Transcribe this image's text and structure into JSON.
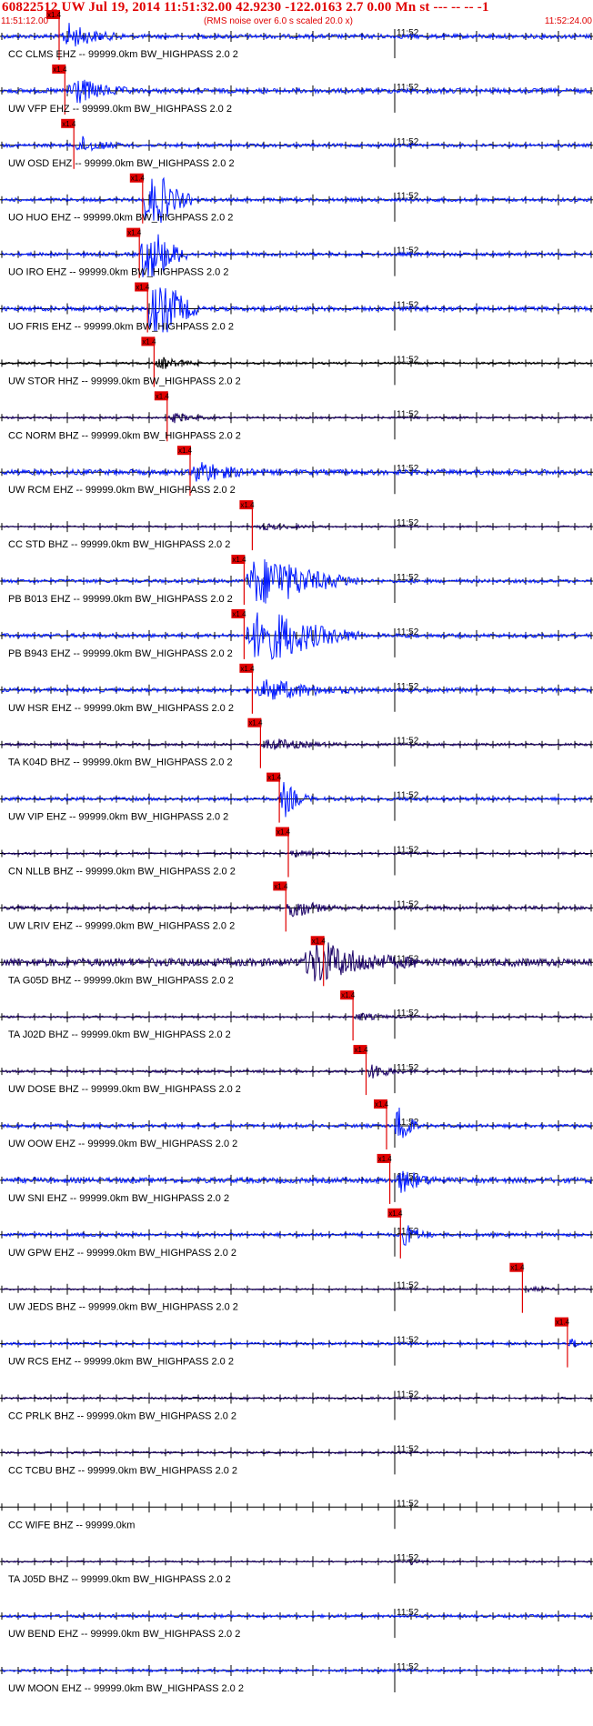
{
  "header": {
    "title": "60822512 UW Jul 19, 2014 11:51:32.00   42.9230 -122.0163  2.7 0.00 Mn st --- -- --   -1",
    "start_time": "11:51:12.00",
    "end_time": "11:52:24.00",
    "scale_note": "(RMS noise over 6.0 s scaled 20.0 x)"
  },
  "chart_data": {
    "type": "line",
    "x_range_seconds": [
      0,
      72
    ],
    "x_start": "11:51:12.00",
    "x_end": "11:52:24.00",
    "minute_mark_label": "11:52",
    "minute_mark_second": 48,
    "tick_interval_seconds": 2,
    "pick_label": "x1.4",
    "colors": {
      "blue": "#0018ff",
      "navy": "#1a0066",
      "black": "#000000",
      "red": "#e00000"
    },
    "traces": [
      {
        "label": "CC CLMS EHZ -- 99999.0km BW_HIGHPASS  2.0  2",
        "color": "blue",
        "pick_s": 7.0,
        "burst": [
          7.0,
          8.0,
          2.5
        ],
        "amp": 1.0
      },
      {
        "label": "UW VFP EHZ -- 99999.0km BW_HIGHPASS  2.0  2",
        "color": "blue",
        "pick_s": 7.7,
        "burst": [
          7.7,
          8.0,
          2.8
        ],
        "amp": 1.1
      },
      {
        "label": "UW OSD EHZ -- 99999.0km BW_HIGHPASS  2.0  2",
        "color": "blue",
        "pick_s": 8.8,
        "burst": [
          8.8,
          6.0,
          2.2
        ],
        "amp": 0.8
      },
      {
        "label": "UO HUO EHZ -- 99999.0km BW_HIGHPASS  2.0  2",
        "color": "blue",
        "pick_s": 17.2,
        "burst": [
          17.2,
          6.0,
          12.0
        ],
        "amp": 0.8
      },
      {
        "label": "UO IRO EHZ -- 99999.0km BW_HIGHPASS  2.0  2",
        "color": "blue",
        "pick_s": 16.8,
        "burst": [
          16.8,
          6.0,
          12.0
        ],
        "amp": 0.8
      },
      {
        "label": "UO FRIS EHZ -- 99999.0km BW_HIGHPASS  2.0  2",
        "color": "blue",
        "pick_s": 17.8,
        "burst": [
          17.8,
          6.0,
          12.0
        ],
        "amp": 1.0
      },
      {
        "label": "UW STOR HHZ -- 99999.0km BW_HIGHPASS  2.0  2",
        "color": "black",
        "pick_s": 18.6,
        "burst": [
          18.6,
          6.0,
          2.5
        ],
        "amp": 0.5
      },
      {
        "label": "CC NORM BHZ -- 99999.0km BW_HIGHPASS  2.0  2",
        "color": "navy",
        "pick_s": 20.2,
        "burst": [
          20.2,
          6.0,
          1.8
        ],
        "amp": 0.5
      },
      {
        "label": "UW RCM EHZ -- 99999.0km BW_HIGHPASS  2.0  2",
        "color": "blue",
        "pick_s": 23.0,
        "burst": [
          23.0,
          8.0,
          2.0
        ],
        "amp": 1.2
      },
      {
        "label": "CC STD BHZ -- 99999.0km BW_HIGHPASS  2.0  2",
        "color": "navy",
        "pick_s": 30.6,
        "burst": [
          30.6,
          10.0,
          1.5
        ],
        "amp": 0.4
      },
      {
        "label": "PB B013 EHZ -- 99999.0km BW_HIGHPASS  2.0  2",
        "color": "blue",
        "pick_s": 29.6,
        "burst": [
          29.6,
          14.0,
          9.0
        ],
        "amp": 0.8
      },
      {
        "label": "PB B943 EHZ -- 99999.0km BW_HIGHPASS  2.0  2",
        "color": "blue",
        "pick_s": 29.6,
        "burst": [
          29.6,
          14.0,
          9.0
        ],
        "amp": 0.9
      },
      {
        "label": "UW HSR EHZ -- 99999.0km BW_HIGHPASS  2.0  2",
        "color": "blue",
        "pick_s": 30.6,
        "burst": [
          30.6,
          14.0,
          2.5
        ],
        "amp": 0.9
      },
      {
        "label": "TA K04D BHZ -- 99999.0km BW_HIGHPASS  2.0  2",
        "color": "navy",
        "pick_s": 31.6,
        "burst": [
          31.6,
          10.0,
          2.0
        ],
        "amp": 0.6
      },
      {
        "label": "UW VIP EHZ -- 99999.0km BW_HIGHPASS  2.0  2",
        "color": "blue",
        "pick_s": 33.9,
        "burst": [
          33.9,
          4.0,
          5.0
        ],
        "amp": 0.8
      },
      {
        "label": "CN NLLB BHZ -- 99999.0km BW_HIGHPASS  2.0  2",
        "color": "navy",
        "pick_s": 35.0,
        "burst": [
          35.0,
          6.0,
          1.2
        ],
        "amp": 0.5
      },
      {
        "label": "UW LRIV EHZ -- 99999.0km BW_HIGHPASS  2.0  2",
        "color": "navy",
        "pick_s": 34.7,
        "burst": [
          34.7,
          6.0,
          3.0
        ],
        "amp": 0.8
      },
      {
        "label": "TA G05D BHZ -- 99999.0km BW_HIGHPASS  2.0  2",
        "color": "navy",
        "pick_s": 39.3,
        "burst": [
          36.5,
          14.0,
          2.5
        ],
        "amp": 1.8
      },
      {
        "label": "TA J02D BHZ -- 99999.0km BW_HIGHPASS  2.0  2",
        "color": "navy",
        "pick_s": 42.9,
        "burst": [
          42.9,
          6.0,
          1.5
        ],
        "amp": 0.5
      },
      {
        "label": "UW DOSE BHZ -- 99999.0km BW_HIGHPASS  2.0  2",
        "color": "navy",
        "pick_s": 44.5,
        "burst": [
          44.5,
          5.0,
          3.0
        ],
        "amp": 0.6
      },
      {
        "label": "UW OOW EHZ -- 99999.0km BW_HIGHPASS  2.0  2",
        "color": "blue",
        "pick_s": 47.0,
        "burst": [
          48.0,
          3.0,
          8.0
        ],
        "amp": 0.8
      },
      {
        "label": "UW SNI EHZ -- 99999.0km BW_HIGHPASS  2.0  2",
        "color": "blue",
        "pick_s": 47.4,
        "burst": [
          48.0,
          6.0,
          2.0
        ],
        "amp": 1.2
      },
      {
        "label": "UW GPW EHZ -- 99999.0km BW_HIGHPASS  2.0  2",
        "color": "blue",
        "pick_s": 48.7,
        "burst": [
          48.7,
          4.0,
          3.0
        ],
        "amp": 0.8
      },
      {
        "label": "UW JEDS BHZ -- 99999.0km BW_HIGHPASS  2.0  2",
        "color": "navy",
        "pick_s": 63.6,
        "burst": [
          63.6,
          6.0,
          1.2
        ],
        "amp": 0.4
      },
      {
        "label": "UW RCS EHZ -- 99999.0km BW_HIGHPASS  2.0  2",
        "color": "blue",
        "pick_s": 69.1,
        "burst": [
          69.1,
          3.0,
          1.5
        ],
        "amp": 0.6
      },
      {
        "label": "CC PRLK BHZ -- 99999.0km BW_HIGHPASS  2.0  2",
        "color": "navy",
        "pick_s": null,
        "burst": null,
        "amp": 0.5
      },
      {
        "label": "CC TCBU BHZ -- 99999.0km BW_HIGHPASS  2.0  2",
        "color": "navy",
        "pick_s": null,
        "burst": null,
        "amp": 0.5
      },
      {
        "label": "CC WIFE BHZ -- 99999.0km",
        "color": "navy",
        "pick_s": null,
        "burst": null,
        "amp": 0.0
      },
      {
        "label": "TA J05D BHZ -- 99999.0km BW_HIGHPASS  2.0  2",
        "color": "navy",
        "pick_s": null,
        "burst": [
          49.5,
          3.0,
          1.5
        ],
        "amp": 0.4
      },
      {
        "label": "UW BEND EHZ -- 99999.0km BW_HIGHPASS  2.0  2",
        "color": "blue",
        "pick_s": null,
        "burst": null,
        "amp": 0.7
      },
      {
        "label": "UW MOON EHZ -- 99999.0km BW_HIGHPASS  2.0  2",
        "color": "blue",
        "pick_s": null,
        "burst": null,
        "amp": 0.6
      }
    ]
  }
}
